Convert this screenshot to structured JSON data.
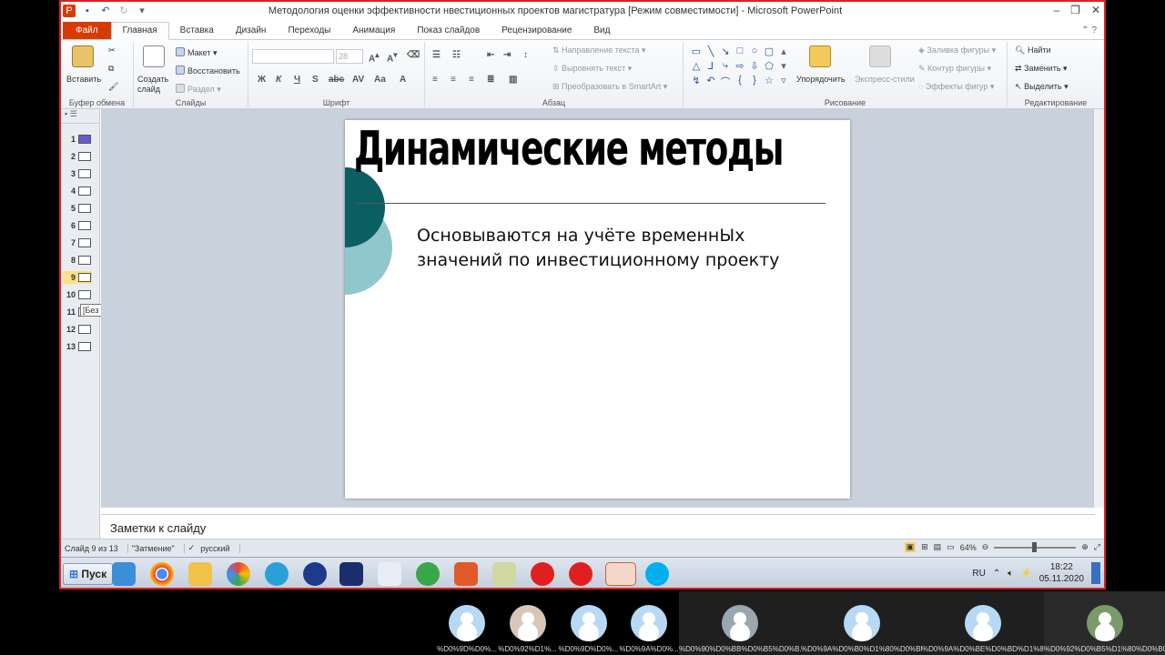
{
  "window": {
    "title": "Методология оценки эффективности нвестиционных проектов магистратура [Режим совместимости]  -  Microsoft PowerPoint"
  },
  "tabs": [
    "Файл",
    "Главная",
    "Вставка",
    "Дизайн",
    "Переходы",
    "Анимация",
    "Показ слайдов",
    "Рецензирование",
    "Вид"
  ],
  "ribbon": {
    "clipboard": {
      "label": "Буфер обмена",
      "paste": "Вставить"
    },
    "slides": {
      "label": "Слайды",
      "new_slide": "Создать слайд",
      "layout": "Макет",
      "reset": "Восстановить",
      "section": "Раздел"
    },
    "font": {
      "label": "Шрифт",
      "size": "28"
    },
    "paragraph": {
      "label": "Абзац",
      "text_direction": "Направление текста",
      "align_text": "Выровнять текст",
      "smartart": "Преобразовать в SmartArt"
    },
    "drawing": {
      "label": "Рисование",
      "arrange": "Упорядочить",
      "quick_styles": "Экспресс-стили",
      "shape_fill": "Заливка фигуры",
      "shape_outline": "Контур фигуры",
      "shape_effects": "Эффекты фигур"
    },
    "editing": {
      "label": "Редактирование",
      "find": "Найти",
      "replace": "Заменить",
      "select": "Выделить"
    }
  },
  "slide_list": {
    "items": [
      "1",
      "2",
      "3",
      "4",
      "5",
      "6",
      "7",
      "8",
      "9",
      "10",
      "11",
      "12",
      "13"
    ],
    "selected": "9",
    "tooltip": "[Без заголовка]"
  },
  "slide": {
    "title": "Динамические методы",
    "body": "Основываются на учёте временнЫх значений по инвестиционному проекту"
  },
  "notes": {
    "placeholder": "Заметки к слайду"
  },
  "statusbar": {
    "slide_counter": "Слайд 9 из 13",
    "theme": "\"Затмение\"",
    "language": "русский",
    "zoom": "64%"
  },
  "taskbar": {
    "start": "Пуск",
    "lang": "RU",
    "time": "18:22",
    "date": "05.11.2020"
  },
  "participants": [
    "%D0%9D%D0%...",
    "%D0%92%D1%...",
    "%D0%9D%D0%...",
    "%D0%9A%D0%...",
    "%D0%90%D0%BB%D0%B5%D0%B...",
    "%D0%9A%D0%B0%D1%80%D0%BF...",
    "%D0%9A%D0%BE%D0%BD%D1%8...",
    "%D0%92%D0%B5%D1%80%D0%B0..."
  ],
  "colors": {
    "accent": "#d83b01",
    "slide_teal_dark": "#0b5f62",
    "slide_teal_light": "#8fc7cc",
    "selection": "#fbe08a"
  }
}
